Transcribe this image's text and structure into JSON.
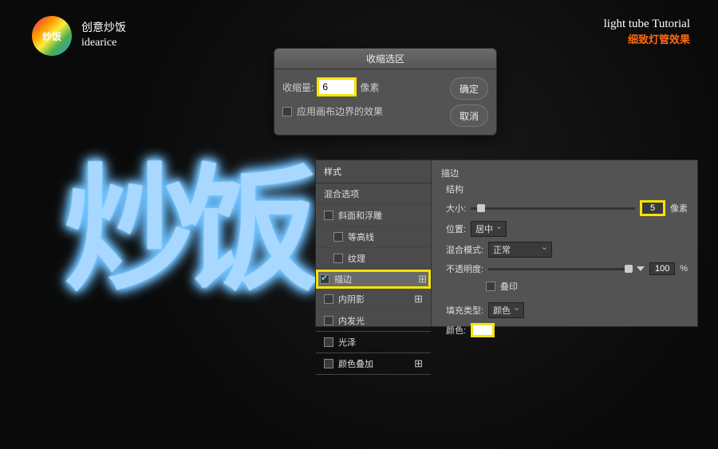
{
  "header": {
    "logo_inner": "炒饭",
    "brand_cn": "创意炒饭",
    "brand_en": "idearice",
    "title_en": "light tube Tutorial",
    "title_cn": "细致灯管效果"
  },
  "artwork": {
    "text": "炒饭"
  },
  "contract_dialog": {
    "title": "收缩选区",
    "amount_label": "收缩量:",
    "amount_value": "6",
    "amount_unit": "像素",
    "canvas_checkbox": "应用画布边界的效果",
    "ok": "确定",
    "cancel": "取消"
  },
  "style_panel": {
    "left": {
      "header": "样式",
      "blending": "混合选项",
      "bevel": "斜面和浮雕",
      "contour": "等高线",
      "texture": "纹理",
      "stroke": "描边",
      "inner_shadow": "内阴影",
      "inner_glow": "内发光",
      "satin": "光泽",
      "color_overlay": "颜色叠加"
    },
    "right": {
      "title": "描边",
      "structure": "结构",
      "size_label": "大小:",
      "size_value": "5",
      "size_unit": "像素",
      "position_label": "位置:",
      "position_value": "居中",
      "blend_label": "混合模式:",
      "blend_value": "正常",
      "opacity_label": "不透明度:",
      "opacity_value": "100",
      "opacity_unit": "%",
      "overprint": "叠印",
      "fill_type_label": "填充类型:",
      "fill_type_value": "颜色",
      "color_label": "颜色:"
    }
  }
}
